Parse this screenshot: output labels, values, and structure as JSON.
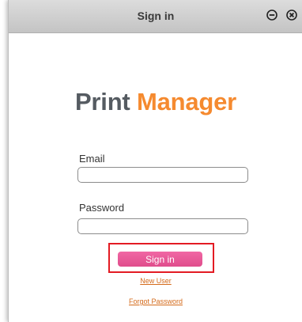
{
  "window": {
    "title": "Sign in"
  },
  "logo": {
    "part1": "Print ",
    "part2": "Manager"
  },
  "form": {
    "email_label": "Email",
    "email_value": "",
    "password_label": "Password",
    "password_value": "",
    "submit_label": "Sign in"
  },
  "links": {
    "new_user": "New User",
    "forgot_password": "Forgot Password"
  },
  "colors": {
    "brand_dark": "#555b61",
    "brand_orange": "#f58a2f",
    "button_pink": "#e8559a",
    "highlight_red": "#e31b23"
  },
  "icons": {
    "minimize": "minus-circle-icon",
    "close": "close-circle-icon"
  }
}
